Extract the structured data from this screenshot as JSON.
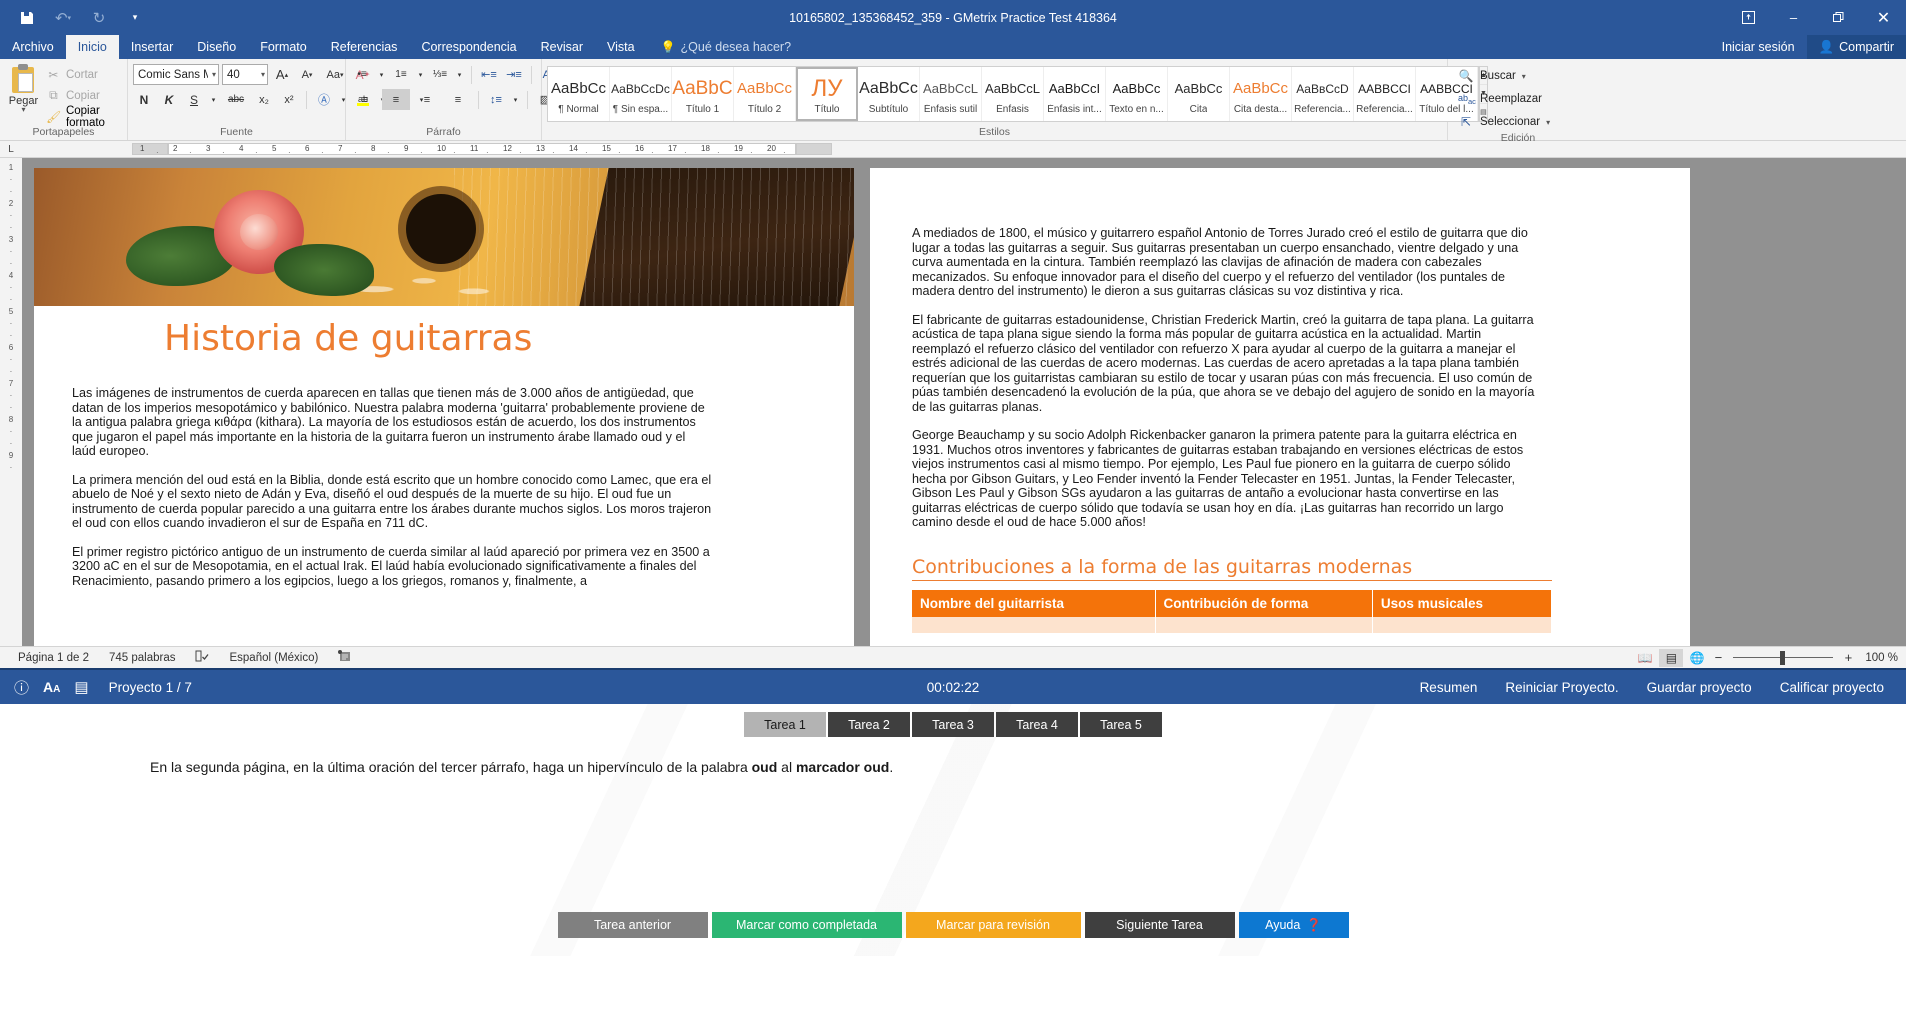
{
  "titlebar": {
    "quick_access": [
      {
        "name": "save-icon",
        "glyph": "⬛"
      },
      {
        "name": "undo-icon",
        "glyph": "↶"
      },
      {
        "name": "redo-icon",
        "glyph": "↻"
      },
      {
        "name": "customize-qat-icon",
        "glyph": "⌵"
      }
    ],
    "title": "10165802_135368452_359 - GMetrix Practice Test 418364",
    "ribbon_display_options": "❐",
    "minimize": "–",
    "restore": "❐",
    "close": "✕"
  },
  "tabs": [
    {
      "label": "Archivo",
      "active": false
    },
    {
      "label": "Inicio",
      "active": true
    },
    {
      "label": "Insertar",
      "active": false
    },
    {
      "label": "Diseño",
      "active": false
    },
    {
      "label": "Formato",
      "active": false
    },
    {
      "label": "Referencias",
      "active": false
    },
    {
      "label": "Correspondencia",
      "active": false
    },
    {
      "label": "Revisar",
      "active": false
    },
    {
      "label": "Vista",
      "active": false
    }
  ],
  "tellme": {
    "placeholder": "¿Qué desea hacer?",
    "icon": "bulb-icon"
  },
  "account": {
    "signin": "Iniciar sesión",
    "share": "Compartir"
  },
  "ribbon": {
    "clipboard": {
      "label": "Portapapeles",
      "paste": "Pegar",
      "commands": [
        {
          "label": "Cortar",
          "icon": "scissors-icon",
          "glyph": "✂",
          "disabled": true
        },
        {
          "label": "Copiar",
          "icon": "copy-icon",
          "glyph": "❐",
          "disabled": true
        },
        {
          "label": "Copiar formato",
          "icon": "format-painter-icon",
          "glyph": "🖌",
          "disabled": false
        }
      ]
    },
    "font": {
      "label": "Fuente",
      "font_name": "Comic Sans M",
      "font_size": "40",
      "grow": "A",
      "shrink": "A",
      "change_case": "Aa",
      "clear_format": "A",
      "bold": "N",
      "italic": "K",
      "underline": "S",
      "strike": "abc",
      "subscript": "x₂",
      "superscript": "x²",
      "text_effects": "A",
      "highlight": "ab",
      "font_color": "A"
    },
    "paragraph": {
      "label": "Párrafo",
      "bullets": "•≡",
      "numbering": "1≡",
      "multilevel": "☰",
      "decrease_indent": "←≡",
      "increase_indent": "→≡",
      "sort": "A↓",
      "show_marks": "¶",
      "align_left": "≡",
      "align_center": "≡",
      "align_right": "≡",
      "justify": "≡",
      "line_spacing": "↕≡",
      "shading": "▤",
      "borders": "⌸"
    },
    "styles": {
      "label": "Estilos",
      "items": [
        {
          "preview": "AaBbCc",
          "name": "¶ Normal",
          "color": "#2b2b2b",
          "size": 15,
          "active": false
        },
        {
          "preview": "AaBbCcDс",
          "name": "¶ Sin espa...",
          "color": "#2b2b2b",
          "size": 12,
          "active": false
        },
        {
          "preview": "AaBbС",
          "name": "Título 1",
          "color": "#ed7d31",
          "size": 19,
          "active": false
        },
        {
          "preview": "AaBbCс",
          "name": "Título 2",
          "color": "#ed7d31",
          "size": 15,
          "active": false
        },
        {
          "preview": "ЛУ",
          "name": "Título",
          "color": "#ed7d31",
          "size": 24,
          "active": true
        },
        {
          "preview": "AaBbCс",
          "name": "Subtítulo",
          "color": "#2b2b2b",
          "size": 16,
          "active": false
        },
        {
          "preview": "AaBbCcL",
          "name": "Énfasis sutil",
          "color": "#555",
          "size": 13,
          "active": false
        },
        {
          "preview": "AaBbCcL",
          "name": "Énfasis",
          "color": "#2b2b2b",
          "size": 13,
          "active": false
        },
        {
          "preview": "AaBbCcI",
          "name": "Énfasis int...",
          "color": "#1a1a1a",
          "size": 13,
          "active": false
        },
        {
          "preview": "AaBbCc",
          "name": "Texto en n...",
          "color": "#1a1a1a",
          "size": 13,
          "active": false
        },
        {
          "preview": "AaBbCc",
          "name": "Cita",
          "color": "#2b2b2b",
          "size": 13,
          "active": false
        },
        {
          "preview": "AaBbCс",
          "name": "Cita desta...",
          "color": "#ed7d31",
          "size": 15,
          "active": false
        },
        {
          "preview": "AаBвCcD",
          "name": "Referencia...",
          "color": "#2b2b2b",
          "size": 12,
          "active": false
        },
        {
          "preview": "AABBCCI",
          "name": "Referencia...",
          "color": "#1a1a1a",
          "size": 12,
          "active": false
        },
        {
          "preview": "AABBCCI",
          "name": "Título del l...",
          "color": "#1a1a1a",
          "size": 12,
          "active": false
        }
      ],
      "scroll_up": "▲",
      "scroll_down": "▼",
      "more": "≣"
    },
    "editing": {
      "label": "Edición",
      "find": "Buscar",
      "replace": "Reemplazar",
      "select": "Seleccionar"
    }
  },
  "ruler": {
    "corner": "L",
    "marks": [
      "1",
      "2",
      "3",
      "4",
      "5",
      "6",
      "7",
      "8",
      "9",
      "10",
      "11",
      "12",
      "13",
      "14",
      "15",
      "16",
      "17",
      "18",
      "19",
      "20"
    ]
  },
  "document": {
    "title": "Historia de guitarras",
    "page1_paragraphs": [
      "Las imágenes de instrumentos de cuerda aparecen en tallas que tienen más de 3.000 años de antigüedad, que datan de los imperios mesopotámico y babilónico. Nuestra palabra moderna 'guitarra' probablemente proviene de la antigua palabra griega κιθάρα (kithara). La mayoría de los estudiosos están de acuerdo, los dos instrumentos que jugaron el papel más importante en la historia de la guitarra fueron un instrumento árabe llamado oud y el laúd europeo.",
      "La primera mención del oud está en la Biblia, donde está escrito que un hombre conocido como Lamec, que era el abuelo de Noé y el sexto nieto de Adán y Eva, diseñó el oud después de la muerte de su hijo. El oud fue un instrumento de cuerda popular parecido a una guitarra entre los árabes durante muchos siglos. Los moros trajeron el oud con ellos cuando invadieron el sur de España en 711 dC.",
      "El primer registro pictórico antiguo de un  instrumento de cuerda similar al laúd apareció por primera vez en 3500 a 3200 aC en el sur de Mesopotamia, en el actual Irak. El laúd había evolucionado significativamente a finales del Renacimiento, pasando primero a los egipcios, luego a los griegos, romanos y, finalmente, a"
    ],
    "page2_paragraphs": [
      "A mediados de 1800, el músico y guitarrero español Antonio de Torres Jurado creó el estilo de guitarra que dio lugar a todas las guitarras a seguir. Sus guitarras presentaban un cuerpo ensanchado, vientre delgado y una curva aumentada en la cintura. También reemplazó las clavijas de afinación de madera con cabezales mecanizados.  Su enfoque innovador para el diseño del cuerpo y el refuerzo del ventilador (los puntales de madera dentro del instrumento) le dieron a sus  guitarras clásicas su voz distintiva y rica.",
      "El fabricante de guitarras estadounidense, Christian Frederick Martin, creó la guitarra de tapa plana. La guitarra acústica de tapa plana sigue siendo la forma más popular de guitarra acústica en la actualidad. Martin reemplazó el refuerzo clásico del ventilador con refuerzo X para ayudar al cuerpo de la guitarra a manejar el estrés adicional de las cuerdas de acero modernas. Las cuerdas de acero apretadas a la tapa plana también requerían que los guitarristas cambiaran su estilo de tocar y usaran púas con más frecuencia. El uso común de púas también desencadenó la evolución de la púa, que ahora se ve debajo del agujero de sonido en la mayoría de las guitarras planas.",
      "George Beauchamp y su socio Adolph Rickenbacker ganaron la primera patente para la guitarra eléctrica en 1931. Muchos otros inventores y fabricantes de guitarras estaban trabajando en versiones eléctricas de estos viejos instrumentos casi al mismo tiempo. Por ejemplo, Les Paul fue pionero en la guitarra de cuerpo sólido hecha por Gibson Guitars, y Leo Fender inventó la Fender Telecaster en 1951. Juntas, la Fender Telecaster, Gibson Les Paul y Gibson SGs ayudaron a las guitarras de antaño a evolucionar hasta convertirse en las guitarras eléctricas de cuerpo sólido que todavía se usan hoy en día. ¡Las guitarras han recorrido un largo camino desde el oud de hace 5.000 años!"
    ],
    "section_heading": "Contribuciones a la forma de las guitarras modernas",
    "table_headers": [
      "Nombre del guitarrista",
      "Contribución de forma",
      "Usos musicales"
    ]
  },
  "statusbar": {
    "page": "Página 1 de 2",
    "words": "745 palabras",
    "proofing_icon": "spellcheck-icon",
    "language": "Español (México)",
    "macro_icon": "macro-icon",
    "views": [
      {
        "name": "read-mode-view",
        "glyph": "▤",
        "selected": false
      },
      {
        "name": "print-layout-view",
        "glyph": "☰",
        "selected": true
      },
      {
        "name": "web-layout-view",
        "glyph": "☷",
        "selected": false
      }
    ],
    "zoom_out": "−",
    "zoom_in": "+",
    "zoom_value": "100 %"
  },
  "gmetrix": {
    "help_icon": "question-circle-icon",
    "text_size_icon": "text-size-icon",
    "notes_icon": "notes-icon",
    "project": "Proyecto 1 / 7",
    "timer": "00:02:22",
    "links": [
      "Resumen",
      "Reiniciar Proyecto.",
      "Guardar proyecto",
      "Calificar proyecto"
    ],
    "task_tabs": [
      {
        "label": "Tarea 1",
        "active": true
      },
      {
        "label": "Tarea 2",
        "active": false
      },
      {
        "label": "Tarea 3",
        "active": false
      },
      {
        "label": "Tarea 4",
        "active": false
      },
      {
        "label": "Tarea 5",
        "active": false
      }
    ],
    "task_instruction": {
      "part1": "En la segunda página, en la última oración del tercer párrafo, haga un hipervínculo de la palabra ",
      "bold1": "oud",
      "part2": " al ",
      "bold2": "marcador oud",
      "part3": "."
    },
    "buttons": {
      "prev": "Tarea anterior",
      "complete": "Marcar como completada",
      "review": "Marcar para revisión",
      "next": "Siguiente Tarea",
      "help": "Ayuda",
      "help_glyph": "❓"
    }
  },
  "colors": {
    "word_blue": "#2b579a",
    "accent_orange": "#ed7d31",
    "table_orange": "#f4730a",
    "green": "#2bb673",
    "amber": "#f4a71d",
    "blue_button": "#0d78d1"
  }
}
